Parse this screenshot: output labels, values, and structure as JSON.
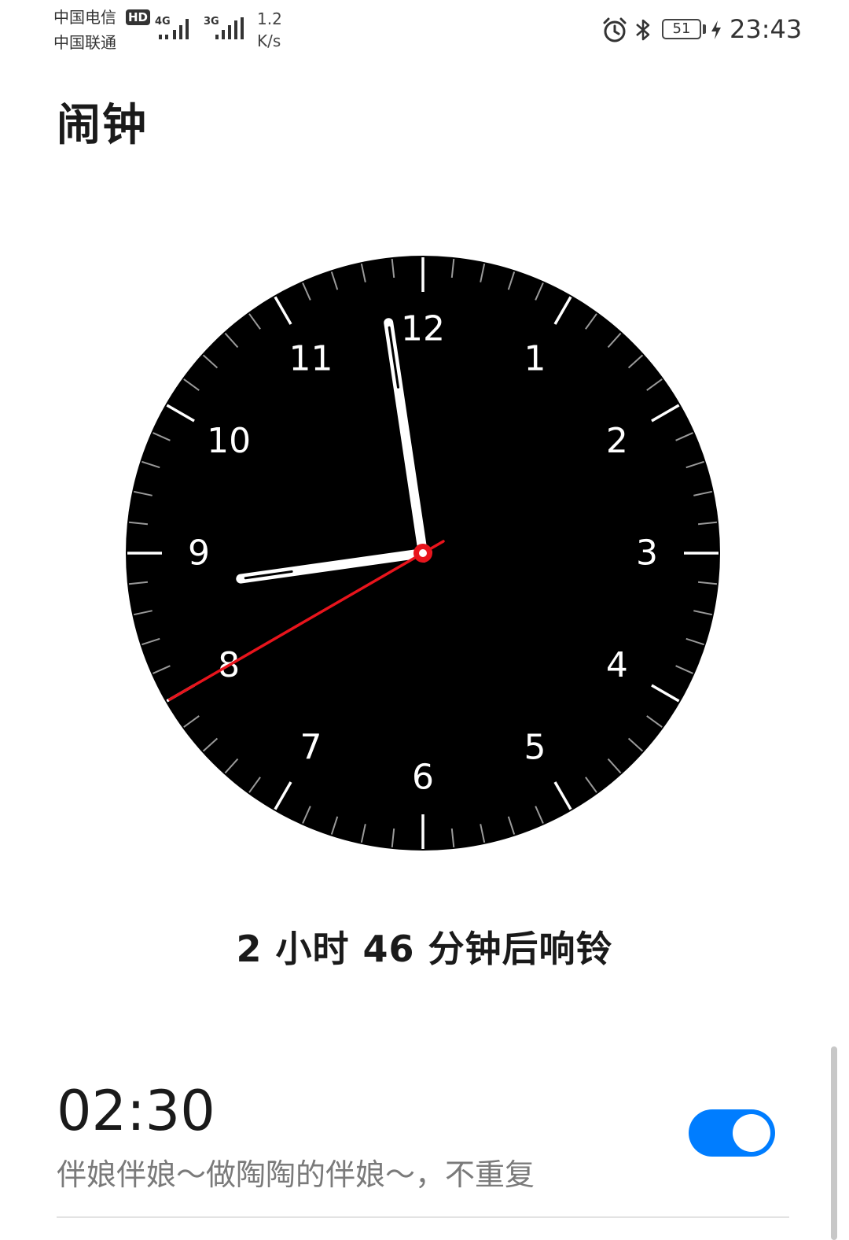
{
  "status_bar": {
    "carrier_1": "中国电信",
    "carrier_2": "中国联通",
    "hd_badge": "HD",
    "network_1": "4G",
    "network_2": "3G",
    "speed_value": "1.2",
    "speed_unit": "K/s",
    "battery_level": "51",
    "time": "23:43",
    "icons": [
      "alarm-icon",
      "bluetooth-icon",
      "battery-icon",
      "charging-icon"
    ]
  },
  "page": {
    "title": "闹钟"
  },
  "analog_clock": {
    "numerals": [
      "12",
      "1",
      "2",
      "3",
      "4",
      "5",
      "6",
      "7",
      "8",
      "9",
      "10",
      "11"
    ],
    "hour": 11,
    "minute": 43,
    "second": 40,
    "face_color": "#000000",
    "hand_color": "#ffffff",
    "second_hand_color": "#e8141c"
  },
  "countdown": {
    "text": "2 小时 46 分钟后响铃"
  },
  "alarms": [
    {
      "time": "02:30",
      "description": "伴娘伴娘～做陶陶的伴娘～，不重复",
      "enabled": true
    }
  ],
  "colors": {
    "accent": "#007dff",
    "secondary_text": "#7a7a7a"
  }
}
